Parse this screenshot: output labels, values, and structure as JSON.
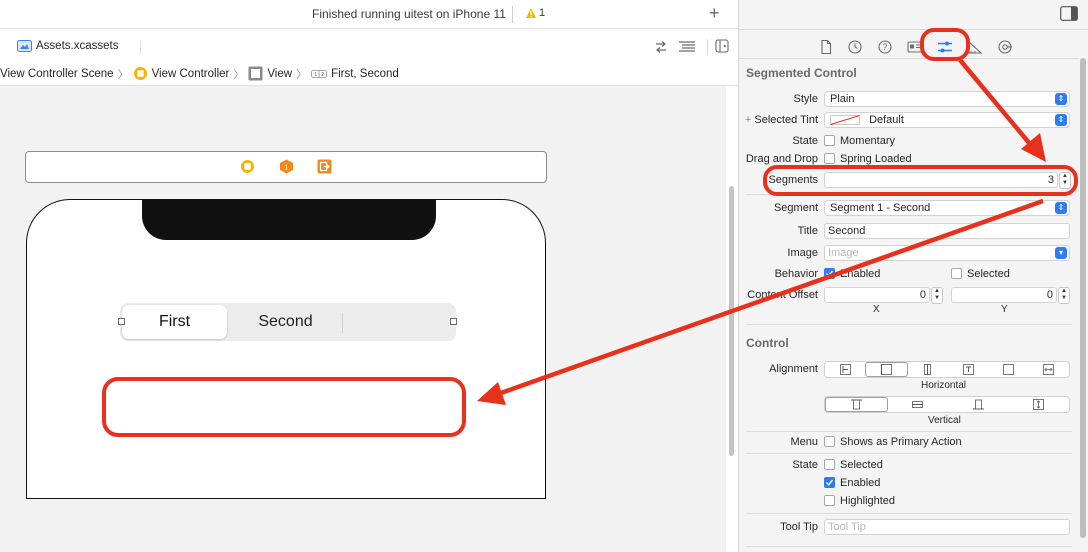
{
  "toolbar": {
    "status": "Finished running uitest on iPhone 11",
    "warning_count": "1",
    "add_label": "+"
  },
  "tab": {
    "label": "Assets.xcassets"
  },
  "breadcrumb": {
    "items": [
      "View Controller Scene",
      "View Controller",
      "View",
      "First, Second"
    ],
    "chevron": "〉"
  },
  "canvas": {
    "segmented_control": {
      "segments": [
        "First",
        "Second",
        ""
      ],
      "selected_index": 0
    }
  },
  "inspector": {
    "segmented_control_section": {
      "title": "Segmented Control",
      "style_label": "Style",
      "style_value": "Plain",
      "selected_tint_label": "Selected Tint",
      "selected_tint_value": "Default",
      "state_label": "State",
      "momentary_label": "Momentary",
      "momentary_checked": false,
      "drag_drop_label": "Drag and Drop",
      "spring_loaded_label": "Spring Loaded",
      "spring_loaded_checked": false,
      "segments_label": "Segments",
      "segments_value": "3",
      "segment_label": "Segment",
      "segment_value": "Segment 1 - Second",
      "title_label": "Title",
      "title_value": "Second",
      "image_label": "Image",
      "image_placeholder": "Image",
      "behavior_label": "Behavior",
      "enabled_label": "Enabled",
      "enabled_checked": true,
      "selected_label": "Selected",
      "selected_checked": false,
      "content_offset_label": "Content Offset",
      "offset_x": "0",
      "offset_y": "0",
      "x_caption": "X",
      "y_caption": "Y"
    },
    "control_section": {
      "title": "Control",
      "alignment_label": "Alignment",
      "horizontal_caption": "Horizontal",
      "vertical_caption": "Vertical",
      "menu_label": "Menu",
      "primary_action_label": "Shows as Primary Action",
      "primary_action_checked": false,
      "state_label": "State",
      "selected_label": "Selected",
      "selected_checked": false,
      "enabled_label": "Enabled",
      "enabled_checked": true,
      "highlighted_label": "Highlighted",
      "highlighted_checked": false,
      "tooltip_label": "Tool Tip",
      "tooltip_placeholder": "Tool Tip"
    }
  },
  "colors": {
    "annotation_red": "#e8311d",
    "accent_blue": "#2d7cf6",
    "warning_yellow": "#f5b400",
    "object_orange": "#f08a1c"
  }
}
